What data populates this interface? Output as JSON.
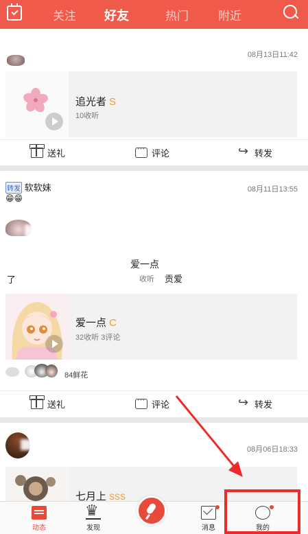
{
  "topbar": {
    "tabs": [
      {
        "label": "关注",
        "active": false
      },
      {
        "label": "好友",
        "active": true
      },
      {
        "label": "热门",
        "active": false
      },
      {
        "label": "附近",
        "active": false
      }
    ]
  },
  "posts": [
    {
      "time": "08月13日11:42",
      "card": {
        "title": "追光者",
        "grade": "S",
        "sub": "10收听"
      },
      "actions": [
        "送礼",
        "评论",
        "转发"
      ]
    },
    {
      "repost_tag": "转发",
      "user": "软软妹",
      "emoji": "😁😁",
      "time": "08月11日13:55",
      "quoted_text_left": "了",
      "quoted_title": "爱一点",
      "quoted_listen": "收听",
      "quoted_tail": "贡爱",
      "card": {
        "title": "爱一点",
        "grade": "C",
        "sub": "32收听  3评论"
      },
      "flowers": "84鲜花",
      "actions": [
        "送礼",
        "评论",
        "转发"
      ]
    },
    {
      "time": "08月06日18:33",
      "card": {
        "title": "七月上",
        "grade": "SSS"
      }
    }
  ],
  "bottombar": {
    "items": [
      {
        "label": "动态",
        "active": true
      },
      {
        "label": "发现",
        "active": false
      },
      {
        "label": "消息",
        "active": false
      },
      {
        "label": "我的",
        "active": false
      }
    ]
  },
  "colors": {
    "brand": "#f05a4a",
    "grade": "#f39a2a",
    "annotation": "#ee2b2b"
  }
}
